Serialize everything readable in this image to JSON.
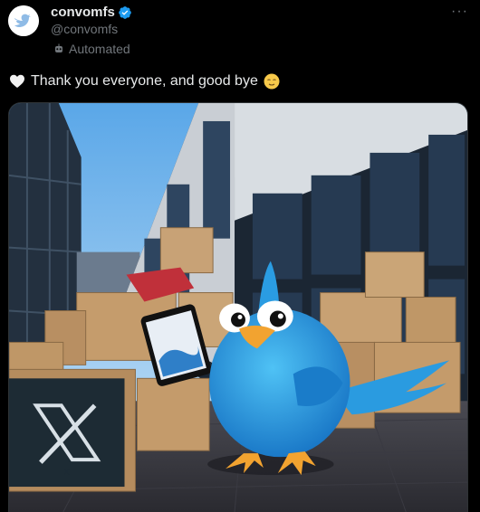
{
  "tweet": {
    "display_name": "convomfs",
    "handle": "@convomfs",
    "automated_label": "Automated",
    "text": "Thank you everyone, and good bye",
    "more_label": "···",
    "colors": {
      "verified": "#1d9bf0",
      "background": "#000000",
      "secondary_text": "#71767b"
    }
  },
  "media": {
    "alt": "Blue bird mascot sitting among cardboard boxes in front of an office building with an X logo box",
    "box_logo": "X"
  },
  "icons": [
    "twitter-logo-avatar",
    "verified-badge-icon",
    "robot-icon",
    "white-heart-emoji",
    "relieved-face-emoji",
    "more-options-icon"
  ]
}
